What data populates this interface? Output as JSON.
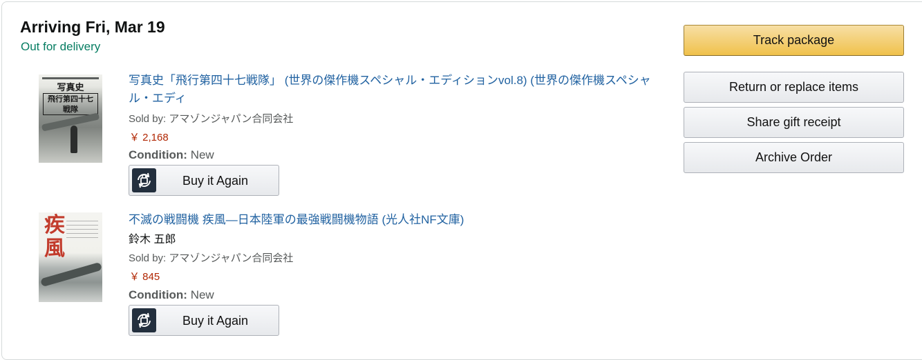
{
  "shipment": {
    "heading": "Arriving Fri, Mar 19",
    "status": "Out for delivery",
    "status_color": "#067d62"
  },
  "actions": {
    "track": "Track package",
    "return": "Return or replace items",
    "gift": "Share gift receipt",
    "archive": "Archive Order"
  },
  "items": [
    {
      "title": "写真史「飛行第四十七戦隊」 (世界の傑作機スペシャル・エディションvol.8) (世界の傑作機スペシャル・エディ",
      "cover_text_line1": "写真史",
      "cover_text_line2": "飛行第四十七戦隊",
      "sold_by": "Sold by: アマゾンジャパン合同会社",
      "price": "￥ 2,168",
      "condition_label": "Condition:",
      "condition_value": "New",
      "buy_again": "Buy it Again",
      "buy_again_icon": "cart-refresh-icon"
    },
    {
      "title": "不滅の戦闘機 疾風―日本陸軍の最強戦闘機物語 (光人社NF文庫)",
      "cover_text_kanji1": "疾",
      "cover_text_kanji2": "風",
      "author": "鈴木 五郎",
      "sold_by": "Sold by: アマゾンジャパン合同会社",
      "price": "￥ 845",
      "condition_label": "Condition:",
      "condition_value": "New",
      "buy_again": "Buy it Again",
      "buy_again_icon": "cart-refresh-icon"
    }
  ],
  "colors": {
    "link": "#2162a1",
    "price": "#b12704",
    "primary_button": "#f0c14b"
  }
}
